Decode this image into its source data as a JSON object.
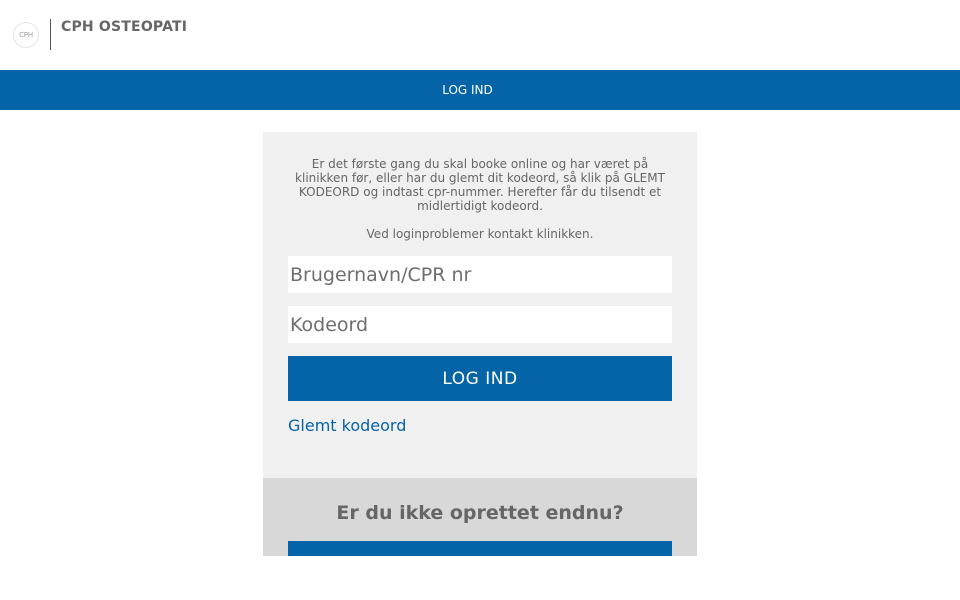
{
  "header": {
    "logo_text": "CPH",
    "brand": "CPH OSTEOPATI"
  },
  "nav": {
    "items": [
      {
        "label": "LOG IND"
      }
    ]
  },
  "login": {
    "intro": "Er det første gang du skal booke online og har været på klinikken før, eller har du glemt dit kodeord, så klik på GLEMT KODEORD og indtast cpr-nummer. Herefter får du tilsendt et midlertidigt kodeord.",
    "contact": "Ved loginproblemer kontakt klinikken.",
    "username": {
      "placeholder": "Brugernavn/CPR nr",
      "value": ""
    },
    "password": {
      "placeholder": "Kodeord",
      "value": ""
    },
    "submit_label": "LOG IND",
    "forgot_label": "Glemt kodeord"
  },
  "signup": {
    "title": "Er du ikke oprettet endnu?",
    "button_label": ""
  },
  "colors": {
    "primary": "#0563a7",
    "panel_bg": "#f0f0f0",
    "signup_bg": "#d8d8d8",
    "text": "#666666"
  }
}
